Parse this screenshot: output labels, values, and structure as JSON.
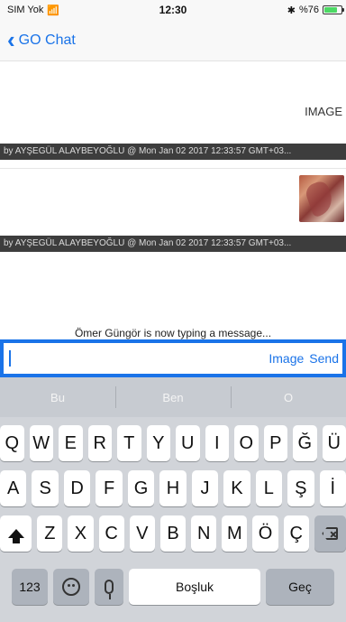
{
  "status": {
    "carrier": "SIM Yok",
    "wifi_icon": "wifi-icon",
    "time": "12:30",
    "bluetooth_icon": "bluetooth-icon",
    "battery_text": "%76",
    "battery_level": 0.76
  },
  "nav": {
    "back_label": "GO Chat"
  },
  "messages": [
    {
      "content": "IMAGE",
      "meta": "by AYŞEGÜL ALAYBEYOĞLU @ Mon Jan 02 2017 12:33:57 GMT+03..."
    },
    {
      "content": "image-thumbnail",
      "meta": "by AYŞEGÜL ALAYBEYOĞLU @ Mon Jan 02 2017 12:33:57 GMT+03..."
    }
  ],
  "typing_indicator": "Ömer Güngör is now typing a message...",
  "input": {
    "placeholder": "",
    "image_label": "Image",
    "send_label": "Send"
  },
  "keyboard": {
    "suggestions": [
      "Bu",
      "Ben",
      "O"
    ],
    "row1": [
      "Q",
      "W",
      "E",
      "R",
      "T",
      "Y",
      "U",
      "I",
      "O",
      "P",
      "Ğ",
      "Ü"
    ],
    "row2": [
      "A",
      "S",
      "D",
      "F",
      "G",
      "H",
      "J",
      "K",
      "L",
      "Ş",
      "İ"
    ],
    "row3": [
      "Z",
      "X",
      "C",
      "V",
      "B",
      "N",
      "M",
      "Ö",
      "Ç"
    ],
    "num_label": "123",
    "space_label": "Boşluk",
    "go_label": "Geç"
  }
}
